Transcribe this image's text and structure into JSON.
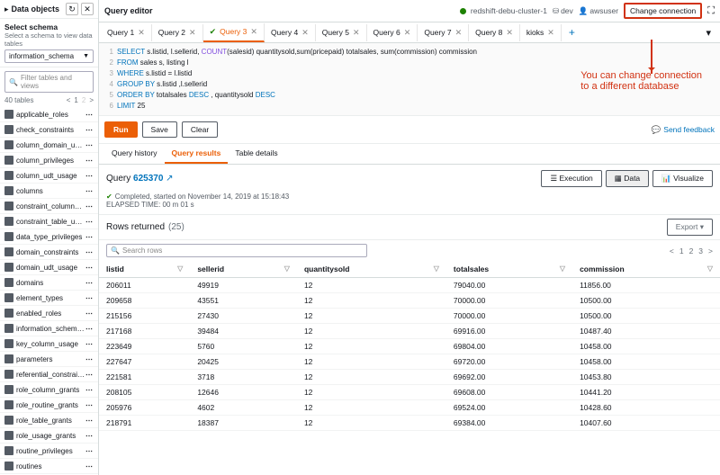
{
  "sidebar": {
    "title": "Data objects",
    "schema_label": "Select schema",
    "schema_sub": "Select a schema to view data tables",
    "schema_value": "information_schema",
    "filter_placeholder": "Filter tables and views",
    "table_count": "40 tables",
    "page_cur": "1",
    "page_total": "2",
    "tables": [
      "applicable_roles",
      "check_constraints",
      "column_domain_usage",
      "column_privileges",
      "column_udt_usage",
      "columns",
      "constraint_column_usage",
      "constraint_table_usage",
      "data_type_privileges",
      "domain_constraints",
      "domain_udt_usage",
      "domains",
      "element_types",
      "enabled_roles",
      "information_schema_catalog_...",
      "key_column_usage",
      "parameters",
      "referential_constraints",
      "role_column_grants",
      "role_routine_grants",
      "role_table_grants",
      "role_usage_grants",
      "routine_privileges",
      "routines"
    ]
  },
  "header": {
    "title": "Query editor",
    "cluster": "redshift-debu-cluster-1",
    "db": "dev",
    "user": "awsuser",
    "change": "Change connection"
  },
  "tabs": [
    {
      "label": "Query 1",
      "active": false
    },
    {
      "label": "Query 2",
      "active": false
    },
    {
      "label": "Query 3",
      "active": true,
      "check": true
    },
    {
      "label": "Query 4",
      "active": false
    },
    {
      "label": "Query 5",
      "active": false
    },
    {
      "label": "Query 6",
      "active": false
    },
    {
      "label": "Query 7",
      "active": false
    },
    {
      "label": "Query 8",
      "active": false
    },
    {
      "label": "kioks",
      "active": false
    }
  ],
  "sql": {
    "l1a": "SELECT",
    "l1b": " s.listid, l.sellerid, ",
    "l1c": "COUNT",
    "l1d": "(salesid) quantitysold,sum(pricepaid) totalsales, sum(commission) commission",
    "l2a": "FROM",
    "l2b": " sales s, listing l",
    "l3a": "WHERE",
    "l3b": " s.listid = l.listid",
    "l4a": "GROUP BY",
    "l4b": " s.listid ,l.sellerid",
    "l5a": "ORDER BY",
    "l5b": " totalsales ",
    "l5c": "DESC",
    "l5d": " , quantitysold ",
    "l5e": "DESC",
    "l6a": "LIMIT",
    "l6b": " 25"
  },
  "annotation": {
    "l1": "You can change connection",
    "l2": "to a different database"
  },
  "controls": {
    "run": "Run",
    "save": "Save",
    "clear": "Clear",
    "feedback": "Send feedback"
  },
  "result_tabs": {
    "history": "Query history",
    "results": "Query results",
    "table": "Table details"
  },
  "query": {
    "label": "Query",
    "id": "625370",
    "status": "Completed, started on November 14, 2019 at 15:18:43",
    "elapsed": "ELAPSED TIME: 00 m 01 s"
  },
  "actions": {
    "execution": "Execution",
    "data": "Data",
    "visualize": "Visualize",
    "export": "Export"
  },
  "rows": {
    "label": "Rows returned",
    "count": "(25)",
    "search": "Search rows",
    "pages": [
      "1",
      "2",
      "3"
    ]
  },
  "columns": [
    "listid",
    "sellerid",
    "quantitysold",
    "totalsales",
    "commission"
  ],
  "data": [
    [
      "206011",
      "49919",
      "12",
      "79040.00",
      "11856.00"
    ],
    [
      "209658",
      "43551",
      "12",
      "70000.00",
      "10500.00"
    ],
    [
      "215156",
      "27430",
      "12",
      "70000.00",
      "10500.00"
    ],
    [
      "217168",
      "39484",
      "12",
      "69916.00",
      "10487.40"
    ],
    [
      "223649",
      "5760",
      "12",
      "69804.00",
      "10458.00"
    ],
    [
      "227647",
      "20425",
      "12",
      "69720.00",
      "10458.00"
    ],
    [
      "221581",
      "3718",
      "12",
      "69692.00",
      "10453.80"
    ],
    [
      "208105",
      "12646",
      "12",
      "69608.00",
      "10441.20"
    ],
    [
      "205976",
      "4602",
      "12",
      "69524.00",
      "10428.60"
    ],
    [
      "218791",
      "18387",
      "12",
      "69384.00",
      "10407.60"
    ]
  ]
}
